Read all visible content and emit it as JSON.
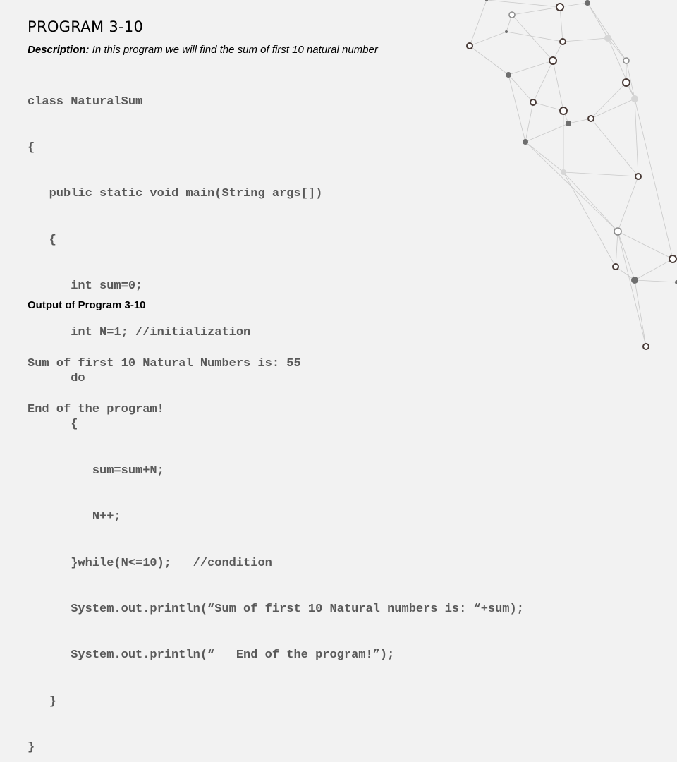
{
  "slide": {
    "title": "PROGRAM 3-10",
    "description_label": "Description:",
    "description_text": " In this program we will find the sum of first 10 natural number",
    "code_lines": [
      "class NaturalSum",
      "{",
      "   public static void main(String args[])",
      "   {",
      "      int sum=0;",
      "      int N=1; //initialization",
      "      do",
      "      {",
      "         sum=sum+N;",
      "         N++;",
      "      }while(N<=10);   //condition",
      "      System.out.println(“Sum of first 10 Natural numbers is: “+sum);",
      "      System.out.println(“   End of the program!”);",
      "   }",
      "}"
    ],
    "output_heading": "Output of Program 3-10",
    "output_lines": [
      "Sum of first 10 Natural Numbers is: 55",
      "End of the program!"
    ]
  }
}
